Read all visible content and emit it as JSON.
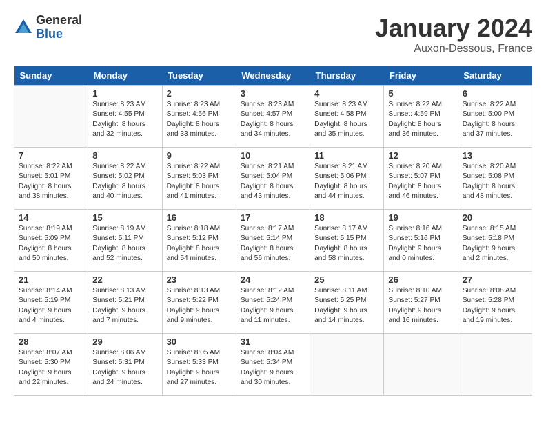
{
  "header": {
    "logo_general": "General",
    "logo_blue": "Blue",
    "month_title": "January 2024",
    "location": "Auxon-Dessous, France"
  },
  "days_of_week": [
    "Sunday",
    "Monday",
    "Tuesday",
    "Wednesday",
    "Thursday",
    "Friday",
    "Saturday"
  ],
  "weeks": [
    [
      {
        "day": "",
        "info": ""
      },
      {
        "day": "1",
        "info": "Sunrise: 8:23 AM\nSunset: 4:55 PM\nDaylight: 8 hours\nand 32 minutes."
      },
      {
        "day": "2",
        "info": "Sunrise: 8:23 AM\nSunset: 4:56 PM\nDaylight: 8 hours\nand 33 minutes."
      },
      {
        "day": "3",
        "info": "Sunrise: 8:23 AM\nSunset: 4:57 PM\nDaylight: 8 hours\nand 34 minutes."
      },
      {
        "day": "4",
        "info": "Sunrise: 8:23 AM\nSunset: 4:58 PM\nDaylight: 8 hours\nand 35 minutes."
      },
      {
        "day": "5",
        "info": "Sunrise: 8:22 AM\nSunset: 4:59 PM\nDaylight: 8 hours\nand 36 minutes."
      },
      {
        "day": "6",
        "info": "Sunrise: 8:22 AM\nSunset: 5:00 PM\nDaylight: 8 hours\nand 37 minutes."
      }
    ],
    [
      {
        "day": "7",
        "info": "Sunrise: 8:22 AM\nSunset: 5:01 PM\nDaylight: 8 hours\nand 38 minutes."
      },
      {
        "day": "8",
        "info": "Sunrise: 8:22 AM\nSunset: 5:02 PM\nDaylight: 8 hours\nand 40 minutes."
      },
      {
        "day": "9",
        "info": "Sunrise: 8:22 AM\nSunset: 5:03 PM\nDaylight: 8 hours\nand 41 minutes."
      },
      {
        "day": "10",
        "info": "Sunrise: 8:21 AM\nSunset: 5:04 PM\nDaylight: 8 hours\nand 43 minutes."
      },
      {
        "day": "11",
        "info": "Sunrise: 8:21 AM\nSunset: 5:06 PM\nDaylight: 8 hours\nand 44 minutes."
      },
      {
        "day": "12",
        "info": "Sunrise: 8:20 AM\nSunset: 5:07 PM\nDaylight: 8 hours\nand 46 minutes."
      },
      {
        "day": "13",
        "info": "Sunrise: 8:20 AM\nSunset: 5:08 PM\nDaylight: 8 hours\nand 48 minutes."
      }
    ],
    [
      {
        "day": "14",
        "info": "Sunrise: 8:19 AM\nSunset: 5:09 PM\nDaylight: 8 hours\nand 50 minutes."
      },
      {
        "day": "15",
        "info": "Sunrise: 8:19 AM\nSunset: 5:11 PM\nDaylight: 8 hours\nand 52 minutes."
      },
      {
        "day": "16",
        "info": "Sunrise: 8:18 AM\nSunset: 5:12 PM\nDaylight: 8 hours\nand 54 minutes."
      },
      {
        "day": "17",
        "info": "Sunrise: 8:17 AM\nSunset: 5:14 PM\nDaylight: 8 hours\nand 56 minutes."
      },
      {
        "day": "18",
        "info": "Sunrise: 8:17 AM\nSunset: 5:15 PM\nDaylight: 8 hours\nand 58 minutes."
      },
      {
        "day": "19",
        "info": "Sunrise: 8:16 AM\nSunset: 5:16 PM\nDaylight: 9 hours\nand 0 minutes."
      },
      {
        "day": "20",
        "info": "Sunrise: 8:15 AM\nSunset: 5:18 PM\nDaylight: 9 hours\nand 2 minutes."
      }
    ],
    [
      {
        "day": "21",
        "info": "Sunrise: 8:14 AM\nSunset: 5:19 PM\nDaylight: 9 hours\nand 4 minutes."
      },
      {
        "day": "22",
        "info": "Sunrise: 8:13 AM\nSunset: 5:21 PM\nDaylight: 9 hours\nand 7 minutes."
      },
      {
        "day": "23",
        "info": "Sunrise: 8:13 AM\nSunset: 5:22 PM\nDaylight: 9 hours\nand 9 minutes."
      },
      {
        "day": "24",
        "info": "Sunrise: 8:12 AM\nSunset: 5:24 PM\nDaylight: 9 hours\nand 11 minutes."
      },
      {
        "day": "25",
        "info": "Sunrise: 8:11 AM\nSunset: 5:25 PM\nDaylight: 9 hours\nand 14 minutes."
      },
      {
        "day": "26",
        "info": "Sunrise: 8:10 AM\nSunset: 5:27 PM\nDaylight: 9 hours\nand 16 minutes."
      },
      {
        "day": "27",
        "info": "Sunrise: 8:08 AM\nSunset: 5:28 PM\nDaylight: 9 hours\nand 19 minutes."
      }
    ],
    [
      {
        "day": "28",
        "info": "Sunrise: 8:07 AM\nSunset: 5:30 PM\nDaylight: 9 hours\nand 22 minutes."
      },
      {
        "day": "29",
        "info": "Sunrise: 8:06 AM\nSunset: 5:31 PM\nDaylight: 9 hours\nand 24 minutes."
      },
      {
        "day": "30",
        "info": "Sunrise: 8:05 AM\nSunset: 5:33 PM\nDaylight: 9 hours\nand 27 minutes."
      },
      {
        "day": "31",
        "info": "Sunrise: 8:04 AM\nSunset: 5:34 PM\nDaylight: 9 hours\nand 30 minutes."
      },
      {
        "day": "",
        "info": ""
      },
      {
        "day": "",
        "info": ""
      },
      {
        "day": "",
        "info": ""
      }
    ]
  ]
}
